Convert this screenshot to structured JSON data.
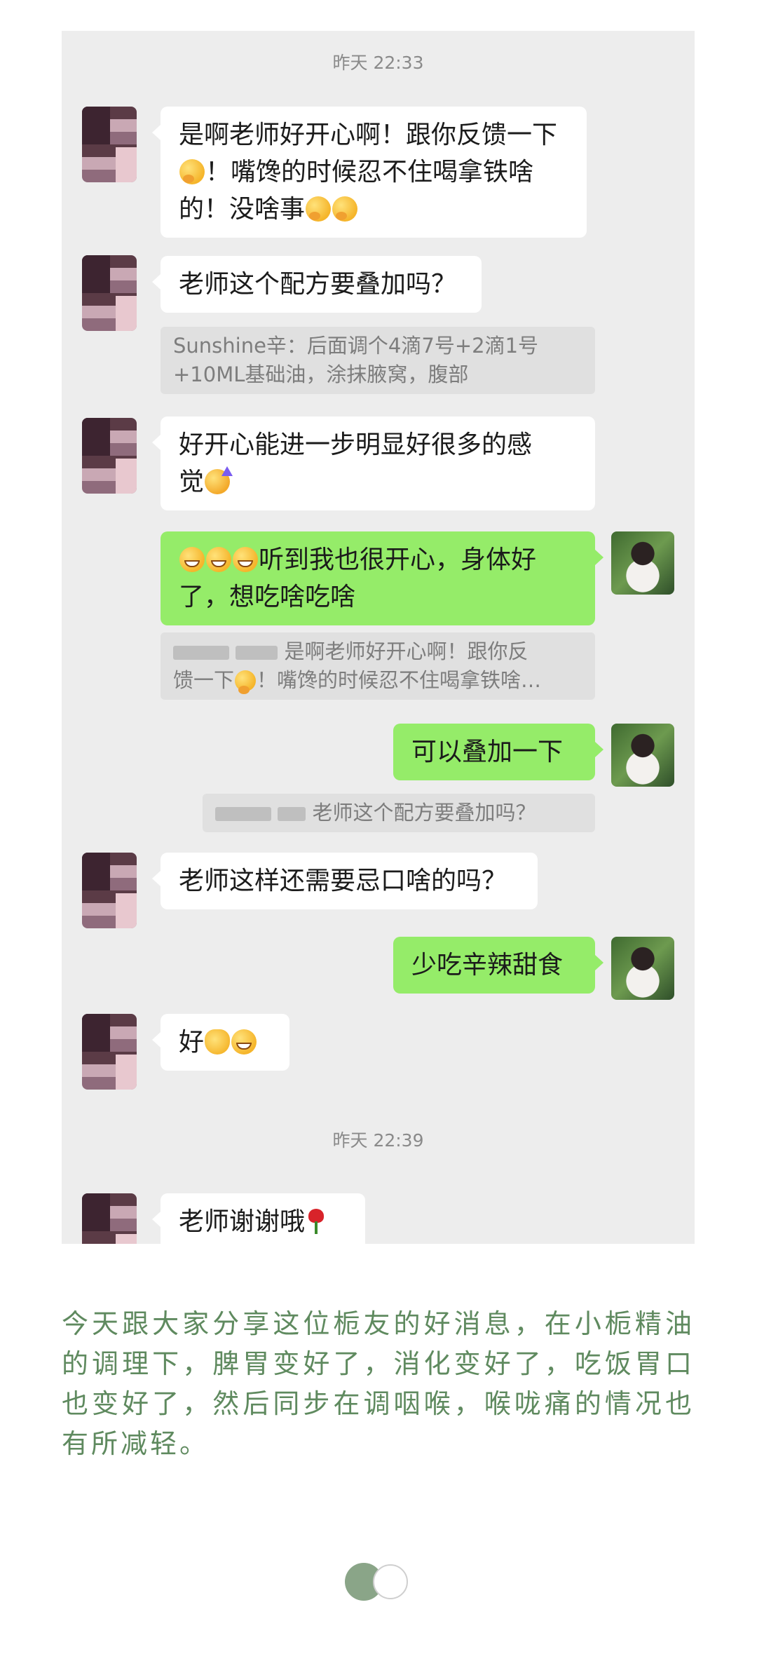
{
  "chat": {
    "timestamp1": "昨天 22:33",
    "timestamp2": "昨天 22:39",
    "messages": [
      {
        "line1": "是啊老师好开心啊！跟你反馈一下",
        "line2": "！嘴馋的时候忍不住喝拿铁啥",
        "line3": "的！没啥事"
      },
      {
        "text": "老师这个配方要叠加吗？"
      },
      {
        "quote_line1": "Sunshine辛：后面调个4滴7号+2滴1号",
        "quote_line2": "+10ML基础油，涂抹腋窝，腹部"
      },
      {
        "line1": "好开心能进一步明显好很多的感",
        "line2": "觉"
      },
      {
        "line1": "听到我也很开心，身体好",
        "line2": "了，想吃啥吃啥"
      },
      {
        "quote_line1": "是啊老师好开心啊！跟你反",
        "quote_line2_a": "馈一下",
        "quote_line2_b": "！嘴馋的时候忍不住喝拿铁啥…"
      },
      {
        "text": "可以叠加一下"
      },
      {
        "quote": "老师这个配方要叠加吗？"
      },
      {
        "text": "老师这样还需要忌口啥的吗？"
      },
      {
        "text": "少吃辛辣甜食"
      },
      {
        "text": "好"
      },
      {
        "text": "老师谢谢哦"
      }
    ],
    "emoji": {
      "think": "thinking-face",
      "grin": "grinning-face",
      "party": "partying-face",
      "ok": "ok-hand",
      "rose": "rose"
    }
  },
  "article": {
    "text": "今天跟大家分享这位栀友的好消息，在小栀精油的调理下，脾胃变好了，消化变好了，吃饭胃口也变好了，然后同步在调咽喉，喉咙痛的情况也有所减轻。"
  },
  "pager": {
    "active_index": 1,
    "total": 2
  },
  "colors": {
    "outgoing": "#95ec69",
    "incoming": "#ffffff",
    "chat_bg": "#ededed",
    "article_text": "#5f8a5f"
  }
}
